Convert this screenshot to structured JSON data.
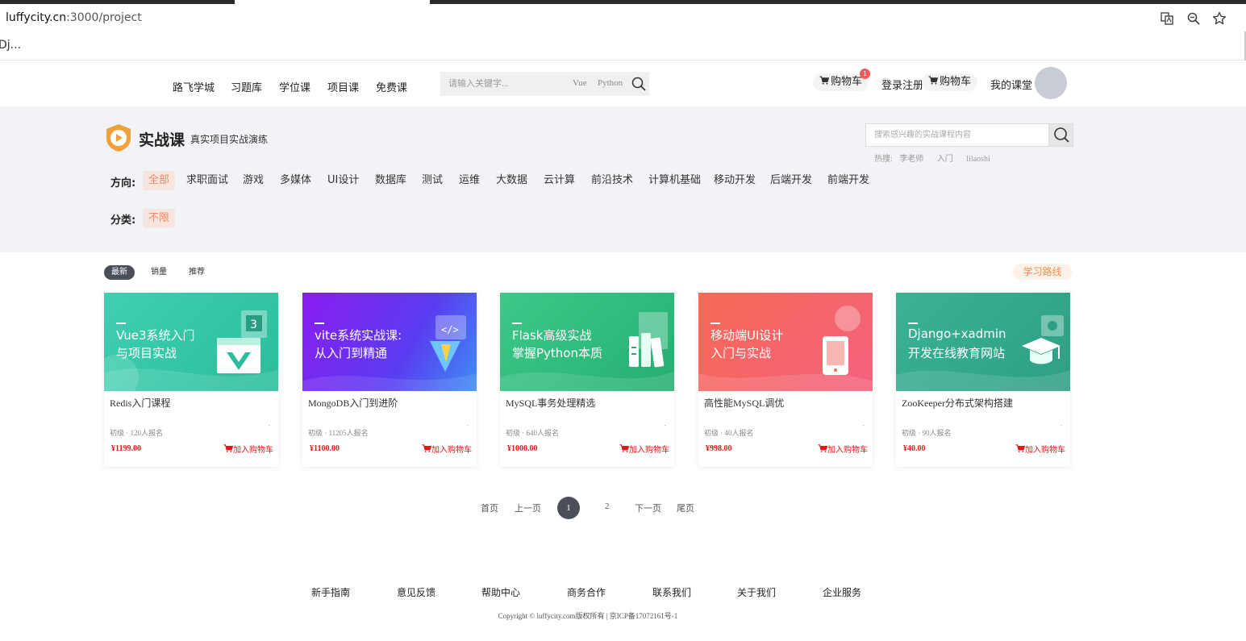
{
  "browser": {
    "url_host": "luffycity.cn",
    "url_path": ":3000/project",
    "bookmark": "Dj..."
  },
  "header": {
    "nav": [
      "路飞学城",
      "习题库",
      "学位课",
      "项目课",
      "免费课"
    ],
    "search_placeholder": "请输入关键字...",
    "search_hot": [
      "Vue",
      "Python"
    ],
    "cart_label": "购物车",
    "cart_badge": "1",
    "login_register": "登录注册",
    "cart_label_2": "购物车",
    "my_classroom": "我的课堂"
  },
  "banner": {
    "title": "实战课",
    "subtitle": "真实项目实战演练",
    "search_placeholder": "搜索感兴趣的实战课程内容",
    "hot_label": "热搜:",
    "hot_items": [
      "李老师",
      "入门",
      "lilaoshi"
    ],
    "direction_label": "方向:",
    "directions": [
      "全部",
      "求职面试",
      "游戏",
      "多媒体",
      "UI设计",
      "数据库",
      "测试",
      "运维",
      "大数据",
      "云计算",
      "前沿技术",
      "计算机基础",
      "移动开发",
      "后端开发",
      "前端开发"
    ],
    "category_label": "分类:",
    "categories": [
      "不限"
    ]
  },
  "sort": {
    "tabs": [
      "最新",
      "销量",
      "推荐"
    ],
    "route_button": "学习路线"
  },
  "courses": [
    {
      "img_line1": "Vue3系统入门",
      "img_line2": "与项目实战",
      "title": "Redis入门课程",
      "meta": "初级 · 120人报名",
      "price": "¥1199.00",
      "cart": "加入购物车",
      "dot": "."
    },
    {
      "img_line1": "vite系统实战课:",
      "img_line2": "从入门到精通",
      "title": "MongoDB入门到进阶",
      "meta": "初级 · 11205人报名",
      "price": "¥1100.00",
      "cart": "加入购物车",
      "dot": "."
    },
    {
      "img_line1": "Flask高级实战",
      "img_line2": "掌握Python本质",
      "title": "MySQL事务处理精选",
      "meta": "初级 · 640人报名",
      "price": "¥1000.00",
      "cart": "加入购物车",
      "dot": "."
    },
    {
      "img_line1": "移动端UI设计",
      "img_line2": "入门与实战",
      "title": "高性能MySQL调优",
      "meta": "初级 · 40人报名",
      "price": "¥998.00",
      "cart": "加入购物车",
      "dot": "."
    },
    {
      "img_line1": "Django+xadmin",
      "img_line2": "开发在线教育网站",
      "title": "ZooKeeper分布式架构搭建",
      "meta": "初级 · 90人报名",
      "price": "¥40.00",
      "cart": "加入购物车",
      "dot": "."
    }
  ],
  "pagination": {
    "first": "首页",
    "prev": "上一页",
    "current": "1",
    "page2": "2",
    "next": "下一页",
    "last": "尾页"
  },
  "footer": {
    "links": [
      "新手指南",
      "意见反馈",
      "帮助中心",
      "商务合作",
      "联系我们",
      "关于我们",
      "企业服务"
    ],
    "copyright": "Copyright © luffycity.com版权所有 | 京ICP备17072161号-1"
  }
}
